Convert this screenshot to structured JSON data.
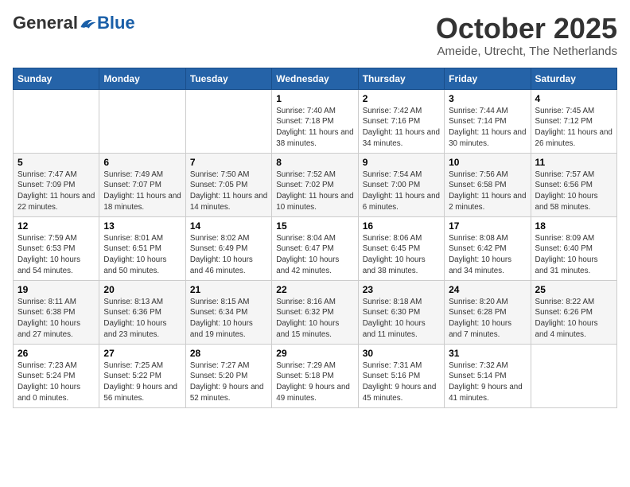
{
  "logo": {
    "general": "General",
    "blue": "Blue"
  },
  "header": {
    "title": "October 2025",
    "subtitle": "Ameide, Utrecht, The Netherlands"
  },
  "weekdays": [
    "Sunday",
    "Monday",
    "Tuesday",
    "Wednesday",
    "Thursday",
    "Friday",
    "Saturday"
  ],
  "weeks": [
    [
      {
        "day": "",
        "info": ""
      },
      {
        "day": "",
        "info": ""
      },
      {
        "day": "",
        "info": ""
      },
      {
        "day": "1",
        "info": "Sunrise: 7:40 AM\nSunset: 7:18 PM\nDaylight: 11 hours and 38 minutes."
      },
      {
        "day": "2",
        "info": "Sunrise: 7:42 AM\nSunset: 7:16 PM\nDaylight: 11 hours and 34 minutes."
      },
      {
        "day": "3",
        "info": "Sunrise: 7:44 AM\nSunset: 7:14 PM\nDaylight: 11 hours and 30 minutes."
      },
      {
        "day": "4",
        "info": "Sunrise: 7:45 AM\nSunset: 7:12 PM\nDaylight: 11 hours and 26 minutes."
      }
    ],
    [
      {
        "day": "5",
        "info": "Sunrise: 7:47 AM\nSunset: 7:09 PM\nDaylight: 11 hours and 22 minutes."
      },
      {
        "day": "6",
        "info": "Sunrise: 7:49 AM\nSunset: 7:07 PM\nDaylight: 11 hours and 18 minutes."
      },
      {
        "day": "7",
        "info": "Sunrise: 7:50 AM\nSunset: 7:05 PM\nDaylight: 11 hours and 14 minutes."
      },
      {
        "day": "8",
        "info": "Sunrise: 7:52 AM\nSunset: 7:02 PM\nDaylight: 11 hours and 10 minutes."
      },
      {
        "day": "9",
        "info": "Sunrise: 7:54 AM\nSunset: 7:00 PM\nDaylight: 11 hours and 6 minutes."
      },
      {
        "day": "10",
        "info": "Sunrise: 7:56 AM\nSunset: 6:58 PM\nDaylight: 11 hours and 2 minutes."
      },
      {
        "day": "11",
        "info": "Sunrise: 7:57 AM\nSunset: 6:56 PM\nDaylight: 10 hours and 58 minutes."
      }
    ],
    [
      {
        "day": "12",
        "info": "Sunrise: 7:59 AM\nSunset: 6:53 PM\nDaylight: 10 hours and 54 minutes."
      },
      {
        "day": "13",
        "info": "Sunrise: 8:01 AM\nSunset: 6:51 PM\nDaylight: 10 hours and 50 minutes."
      },
      {
        "day": "14",
        "info": "Sunrise: 8:02 AM\nSunset: 6:49 PM\nDaylight: 10 hours and 46 minutes."
      },
      {
        "day": "15",
        "info": "Sunrise: 8:04 AM\nSunset: 6:47 PM\nDaylight: 10 hours and 42 minutes."
      },
      {
        "day": "16",
        "info": "Sunrise: 8:06 AM\nSunset: 6:45 PM\nDaylight: 10 hours and 38 minutes."
      },
      {
        "day": "17",
        "info": "Sunrise: 8:08 AM\nSunset: 6:42 PM\nDaylight: 10 hours and 34 minutes."
      },
      {
        "day": "18",
        "info": "Sunrise: 8:09 AM\nSunset: 6:40 PM\nDaylight: 10 hours and 31 minutes."
      }
    ],
    [
      {
        "day": "19",
        "info": "Sunrise: 8:11 AM\nSunset: 6:38 PM\nDaylight: 10 hours and 27 minutes."
      },
      {
        "day": "20",
        "info": "Sunrise: 8:13 AM\nSunset: 6:36 PM\nDaylight: 10 hours and 23 minutes."
      },
      {
        "day": "21",
        "info": "Sunrise: 8:15 AM\nSunset: 6:34 PM\nDaylight: 10 hours and 19 minutes."
      },
      {
        "day": "22",
        "info": "Sunrise: 8:16 AM\nSunset: 6:32 PM\nDaylight: 10 hours and 15 minutes."
      },
      {
        "day": "23",
        "info": "Sunrise: 8:18 AM\nSunset: 6:30 PM\nDaylight: 10 hours and 11 minutes."
      },
      {
        "day": "24",
        "info": "Sunrise: 8:20 AM\nSunset: 6:28 PM\nDaylight: 10 hours and 7 minutes."
      },
      {
        "day": "25",
        "info": "Sunrise: 8:22 AM\nSunset: 6:26 PM\nDaylight: 10 hours and 4 minutes."
      }
    ],
    [
      {
        "day": "26",
        "info": "Sunrise: 7:23 AM\nSunset: 5:24 PM\nDaylight: 10 hours and 0 minutes."
      },
      {
        "day": "27",
        "info": "Sunrise: 7:25 AM\nSunset: 5:22 PM\nDaylight: 9 hours and 56 minutes."
      },
      {
        "day": "28",
        "info": "Sunrise: 7:27 AM\nSunset: 5:20 PM\nDaylight: 9 hours and 52 minutes."
      },
      {
        "day": "29",
        "info": "Sunrise: 7:29 AM\nSunset: 5:18 PM\nDaylight: 9 hours and 49 minutes."
      },
      {
        "day": "30",
        "info": "Sunrise: 7:31 AM\nSunset: 5:16 PM\nDaylight: 9 hours and 45 minutes."
      },
      {
        "day": "31",
        "info": "Sunrise: 7:32 AM\nSunset: 5:14 PM\nDaylight: 9 hours and 41 minutes."
      },
      {
        "day": "",
        "info": ""
      }
    ]
  ]
}
